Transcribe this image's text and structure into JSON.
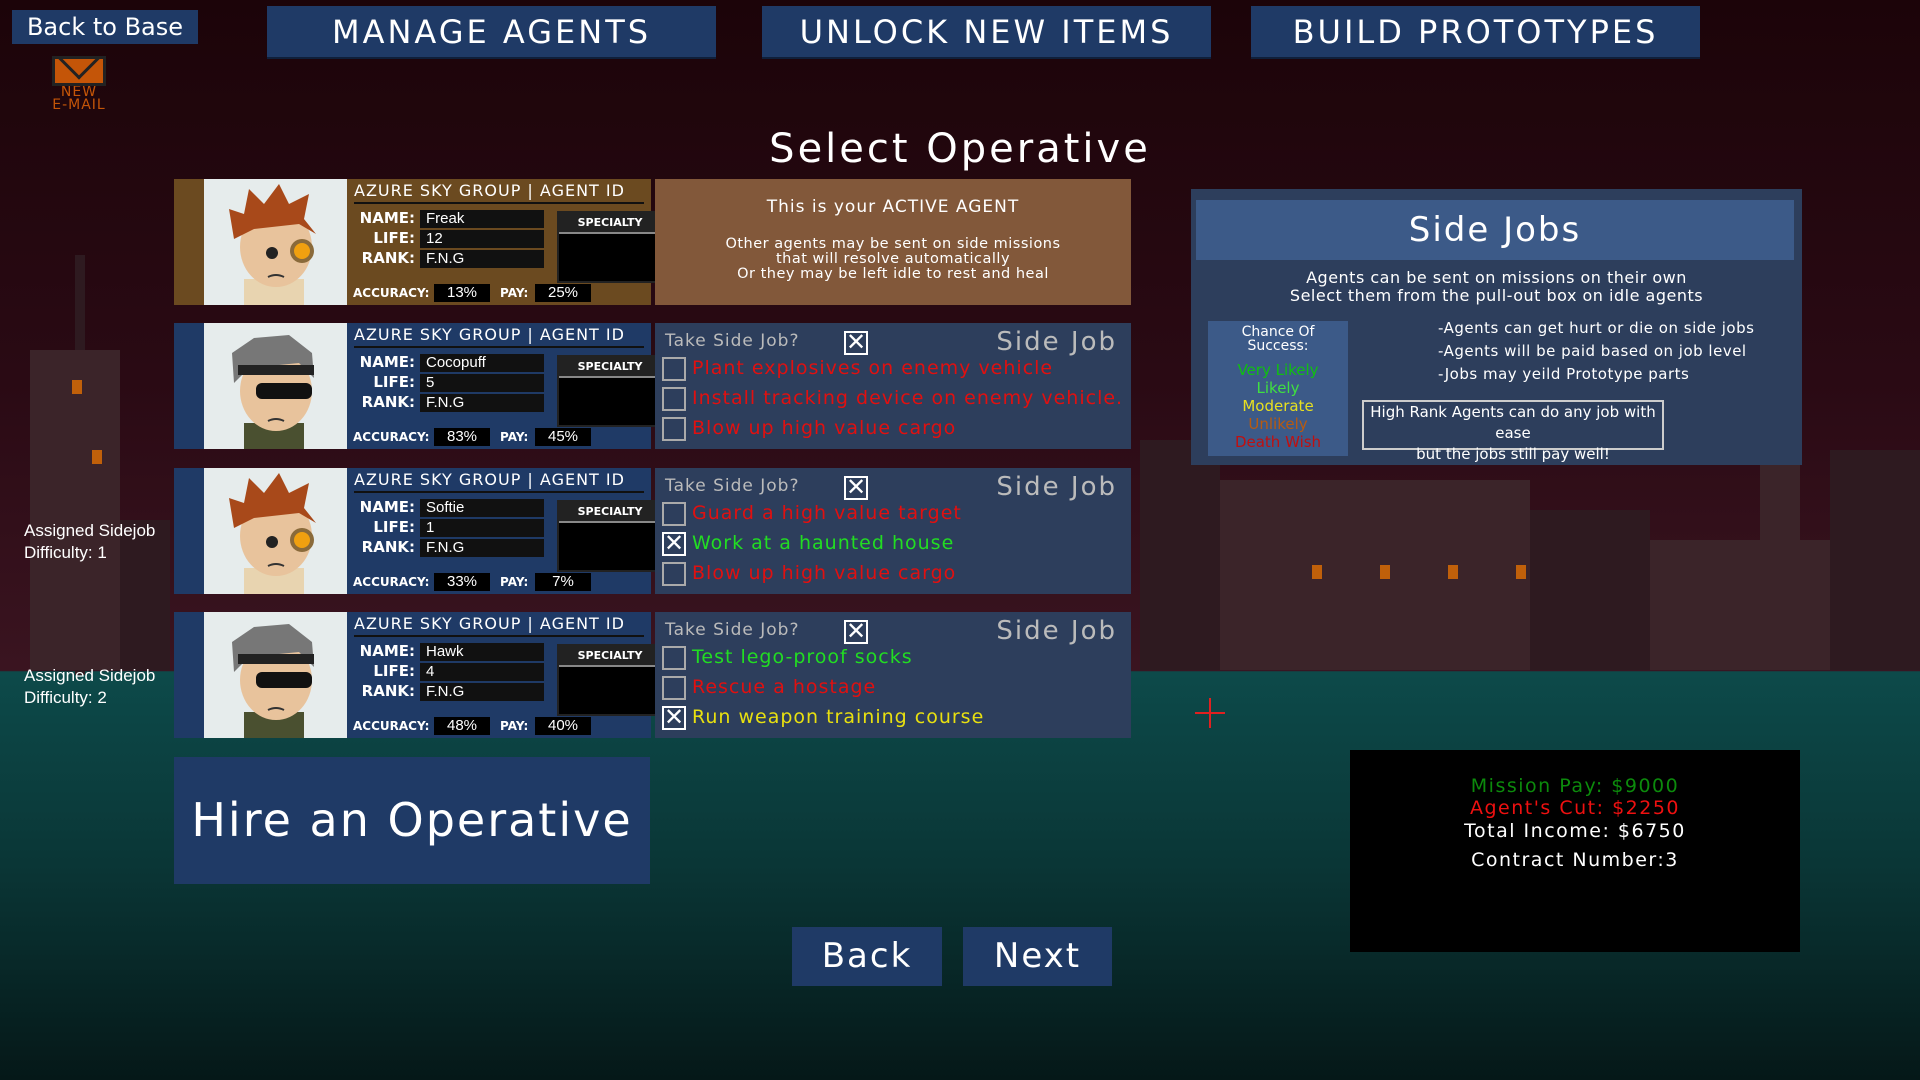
{
  "nav": {
    "back_to_base": "Back to Base",
    "email_label": "NEW\nE-MAIL",
    "email_line1": "NEW",
    "email_line2": "E-MAIL",
    "tabs": [
      "MANAGE AGENTS",
      "UNLOCK NEW ITEMS",
      "BUILD PROTOTYPES"
    ]
  },
  "title": "Select Operative",
  "agents": [
    {
      "org": "AZURE SKY GROUP | AGENT ID",
      "name": "Freak",
      "life": "12",
      "rank": "F.N.G",
      "accuracy": "13%",
      "pay": "25%",
      "portrait": "goggle-redhead",
      "active": true
    },
    {
      "org": "AZURE SKY GROUP | AGENT ID",
      "name": "Cocopuff",
      "life": "5",
      "rank": "F.N.G",
      "accuracy": "83%",
      "pay": "45%",
      "portrait": "sunglasses-grey"
    },
    {
      "org": "AZURE SKY GROUP | AGENT ID",
      "name": "Softie",
      "life": "1",
      "rank": "F.N.G",
      "accuracy": "33%",
      "pay": "7%",
      "portrait": "goggle-redhead"
    },
    {
      "org": "AZURE SKY GROUP | AGENT ID",
      "name": "Hawk",
      "life": "4",
      "rank": "F.N.G",
      "accuracy": "48%",
      "pay": "40%",
      "portrait": "sunglasses-grey"
    }
  ],
  "card_labels": {
    "name": "NAME:",
    "life": "LIFE:",
    "rank": "RANK:",
    "accuracy": "ACCURACY:",
    "pay": "PAY:",
    "specialty": "SPECIALTY"
  },
  "active_panel": {
    "heading": "This is your ACTIVE AGENT",
    "line1": "Other agents may be sent on side missions",
    "line2": "that will resolve automatically",
    "line3": "Or they may be left idle to rest and heal"
  },
  "side_job_panels": [
    {
      "question": "Take Side Job?",
      "title": "Side Job",
      "take": true,
      "jobs": [
        {
          "label": "Plant explosives on enemy vehicle",
          "checked": false,
          "color": "#e01010"
        },
        {
          "label": "Install tracking device on enemy vehicle.",
          "checked": false,
          "color": "#e01010"
        },
        {
          "label": "Blow up high value cargo",
          "checked": false,
          "color": "#e01010"
        }
      ]
    },
    {
      "question": "Take Side Job?",
      "title": "Side Job",
      "take": true,
      "jobs": [
        {
          "label": "Guard a high value target",
          "checked": false,
          "color": "#e01010"
        },
        {
          "label": "Work at a haunted house",
          "checked": true,
          "color": "#22dd22"
        },
        {
          "label": "Blow up high value cargo",
          "checked": false,
          "color": "#e01010"
        }
      ]
    },
    {
      "question": "Take Side Job?",
      "title": "Side Job",
      "take": true,
      "jobs": [
        {
          "label": "Test lego-proof socks",
          "checked": false,
          "color": "#22dd22"
        },
        {
          "label": "Rescue a hostage",
          "checked": false,
          "color": "#e01010"
        },
        {
          "label": "Run weapon training course",
          "checked": true,
          "color": "#e8e010"
        }
      ]
    }
  ],
  "assigned": [
    {
      "line1": "Assigned Sidejob",
      "line2": "Difficulty: 1"
    },
    {
      "line1": "Assigned Sidejob",
      "line2": "Difficulty: 2"
    }
  ],
  "hire_button": "Hire an Operative",
  "back_button": "Back",
  "next_button": "Next",
  "side_jobs_info": {
    "title": "Side Jobs",
    "intro1": "Agents can be sent on missions on their own",
    "intro2": "Select them from the pull-out box on idle agents",
    "chance_title1": "Chance Of",
    "chance_title2": "Success:",
    "chances": [
      {
        "label": "Very Likely",
        "color": "#10c010"
      },
      {
        "label": "Likely",
        "color": "#40e040"
      },
      {
        "label": "Moderate",
        "color": "#e8e020"
      },
      {
        "label": "Unlikely",
        "color": "#b85a10"
      },
      {
        "label": "Death Wish",
        "color": "#c01010"
      }
    ],
    "notes": [
      "-Agents can get hurt or die on side jobs",
      "-Agents will be paid based on job level",
      "-Jobs may yeild Prototype parts"
    ],
    "tip1": "High Rank Agents can do any job with ease",
    "tip2": "but the jobs still pay well!"
  },
  "summary": {
    "mission_pay": "Mission Pay: $9000",
    "agents_cut": "Agent's Cut: $2250",
    "total_income": "Total Income: $6750",
    "contract": "Contract Number:3"
  }
}
